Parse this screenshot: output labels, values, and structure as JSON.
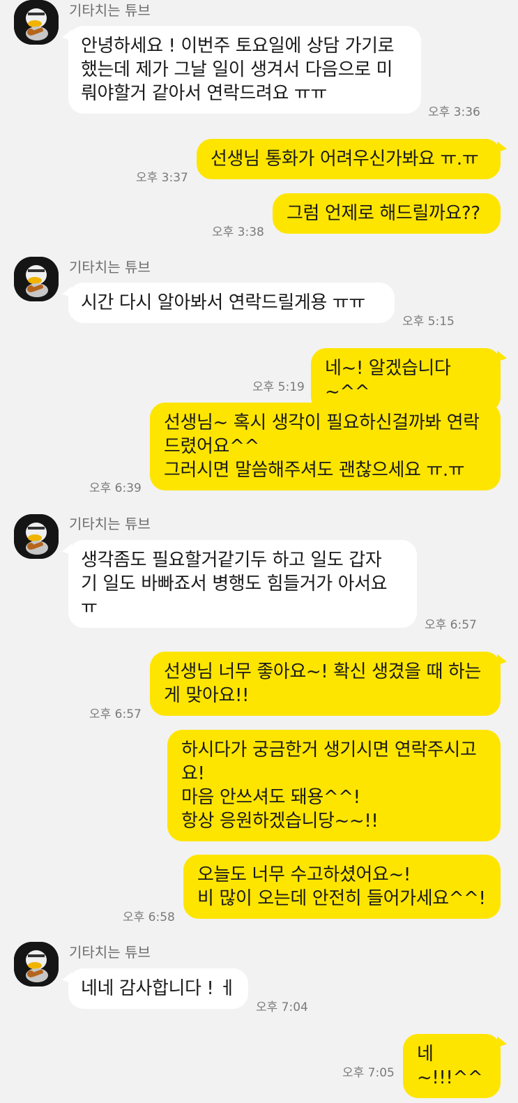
{
  "sender_name": "기타치는 튜브",
  "messages": [
    {
      "direction": "in",
      "text": "안녕하세요 ! 이번주 토요일에 상담 가기로\n했는데 제가 그날 일이 생겨서 다음으로 미\n뤄야할거 같아서 연락드려요 ㅠㅠ",
      "time": "오후 3:36"
    },
    {
      "direction": "out",
      "text": "선생님 통화가 어려우신가봐요 ㅠ.ㅠ",
      "time": "오후 3:37"
    },
    {
      "direction": "out",
      "text": "그럼 언제로 해드릴까요??",
      "time": "오후 3:38"
    },
    {
      "direction": "in",
      "text": "시간 다시 알아봐서 연락드릴게용 ㅠㅠ",
      "time": "오후 5:15"
    },
    {
      "direction": "out",
      "text": "네~! 알겠습니다~^^",
      "time": "오후 5:19"
    },
    {
      "direction": "out",
      "text": "선생님~ 혹시 생각이 필요하신걸까봐 연락\n드렸어요^^\n그러시면 말씀해주셔도 괜찮으세요 ㅠ.ㅠ",
      "time": "오후 6:39"
    },
    {
      "direction": "in",
      "text": "생각좀도 필요할거같기두 하고 일도 갑자\n기 일도 바빠죠서 병행도 힘들거가 아서요\nㅠ",
      "time": "오후 6:57"
    },
    {
      "direction": "out",
      "text": "선생님 너무 좋아요~! 확신 생겼을 때 하는\n게 맞아요!!",
      "time": "오후 6:57"
    },
    {
      "direction": "out",
      "text": "하시다가 궁금한거 생기시면 연락주시고\n요!\n마음 안쓰셔도 돼용^^!\n항상 응원하겠습니당~~!!",
      "time": ""
    },
    {
      "direction": "out",
      "text": "오늘도 너무 수고하셨어요~!\n비 많이 오는데 안전히 들어가세요^^!",
      "time": "오후 6:58"
    },
    {
      "direction": "in",
      "text": "네네 감사합니다 ! ㅔ",
      "time": "오후 7:04"
    },
    {
      "direction": "out",
      "text": "네~!!!^^",
      "time": "오후 7:05"
    }
  ]
}
